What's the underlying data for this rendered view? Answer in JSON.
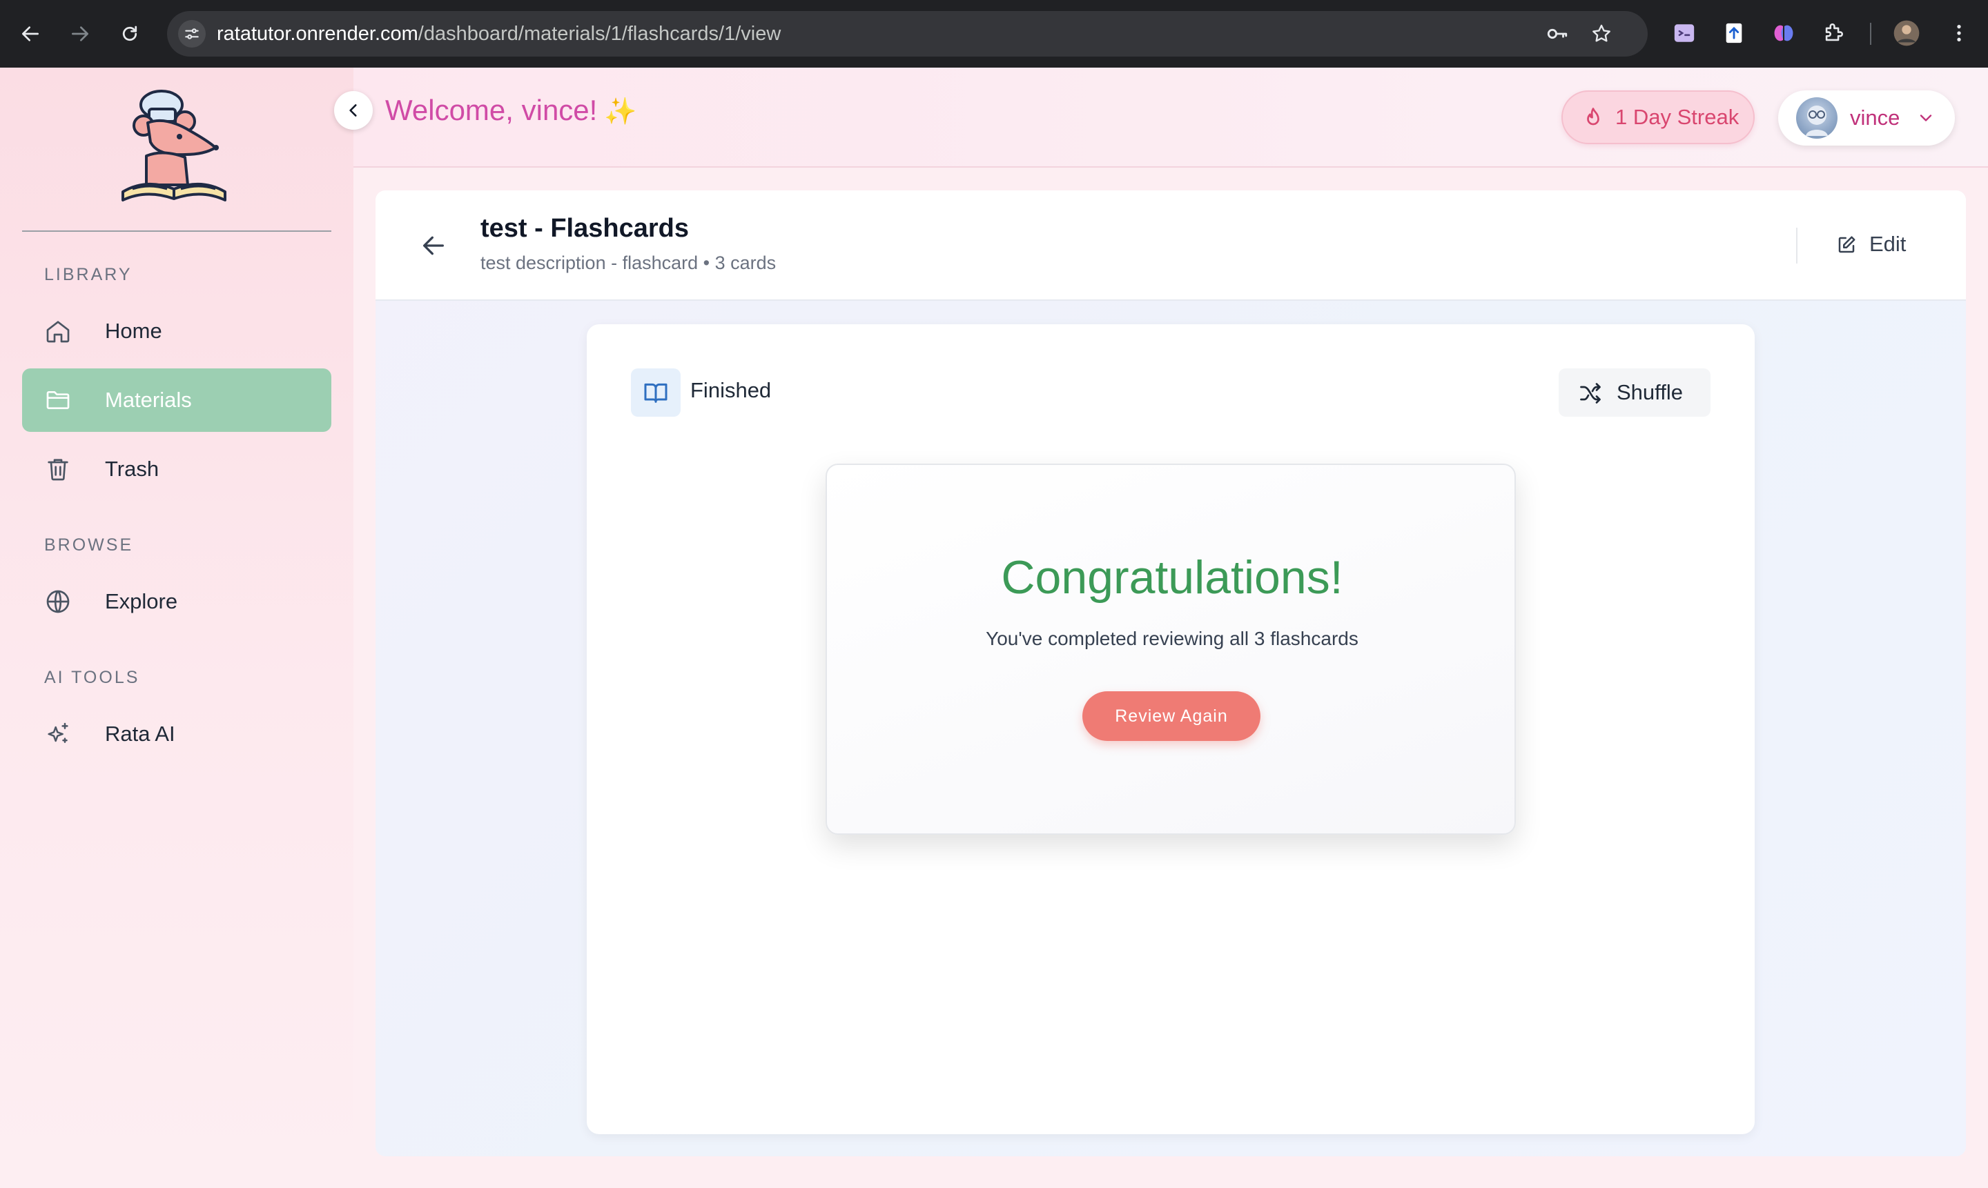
{
  "browser": {
    "url_host": "ratatutor.onrender.com",
    "url_path": "/dashboard/materials/1/flashcards/1/view"
  },
  "sidebar": {
    "sections": [
      {
        "label": "LIBRARY"
      },
      {
        "label": "BROWSE"
      },
      {
        "label": "AI TOOLS"
      }
    ],
    "items": [
      {
        "label": "Home",
        "icon": "home-icon"
      },
      {
        "label": "Materials",
        "icon": "folder-icon",
        "active": true
      },
      {
        "label": "Trash",
        "icon": "trash-icon"
      },
      {
        "label": "Explore",
        "icon": "globe-icon"
      },
      {
        "label": "Rata AI",
        "icon": "sparkles-icon"
      }
    ],
    "active_color": "#9ccfb2"
  },
  "header": {
    "welcome": "Welcome, vince!",
    "sparkle": "✨",
    "streak": "1 Day Streak",
    "username": "vince"
  },
  "page": {
    "title": "test - Flashcards",
    "subtitle": "test description - flashcard • 3 cards",
    "edit_label": "Edit"
  },
  "study": {
    "status": "Finished",
    "shuffle_label": "Shuffle",
    "congrats_title": "Congratulations!",
    "congrats_text": "You've completed reviewing all 3 flashcards",
    "review_again": "Review Again"
  },
  "colors": {
    "welcome": "#d04ba6",
    "streak_text": "#d9466f",
    "congrats": "#3c9a57",
    "review_button": "#ef7b74"
  }
}
